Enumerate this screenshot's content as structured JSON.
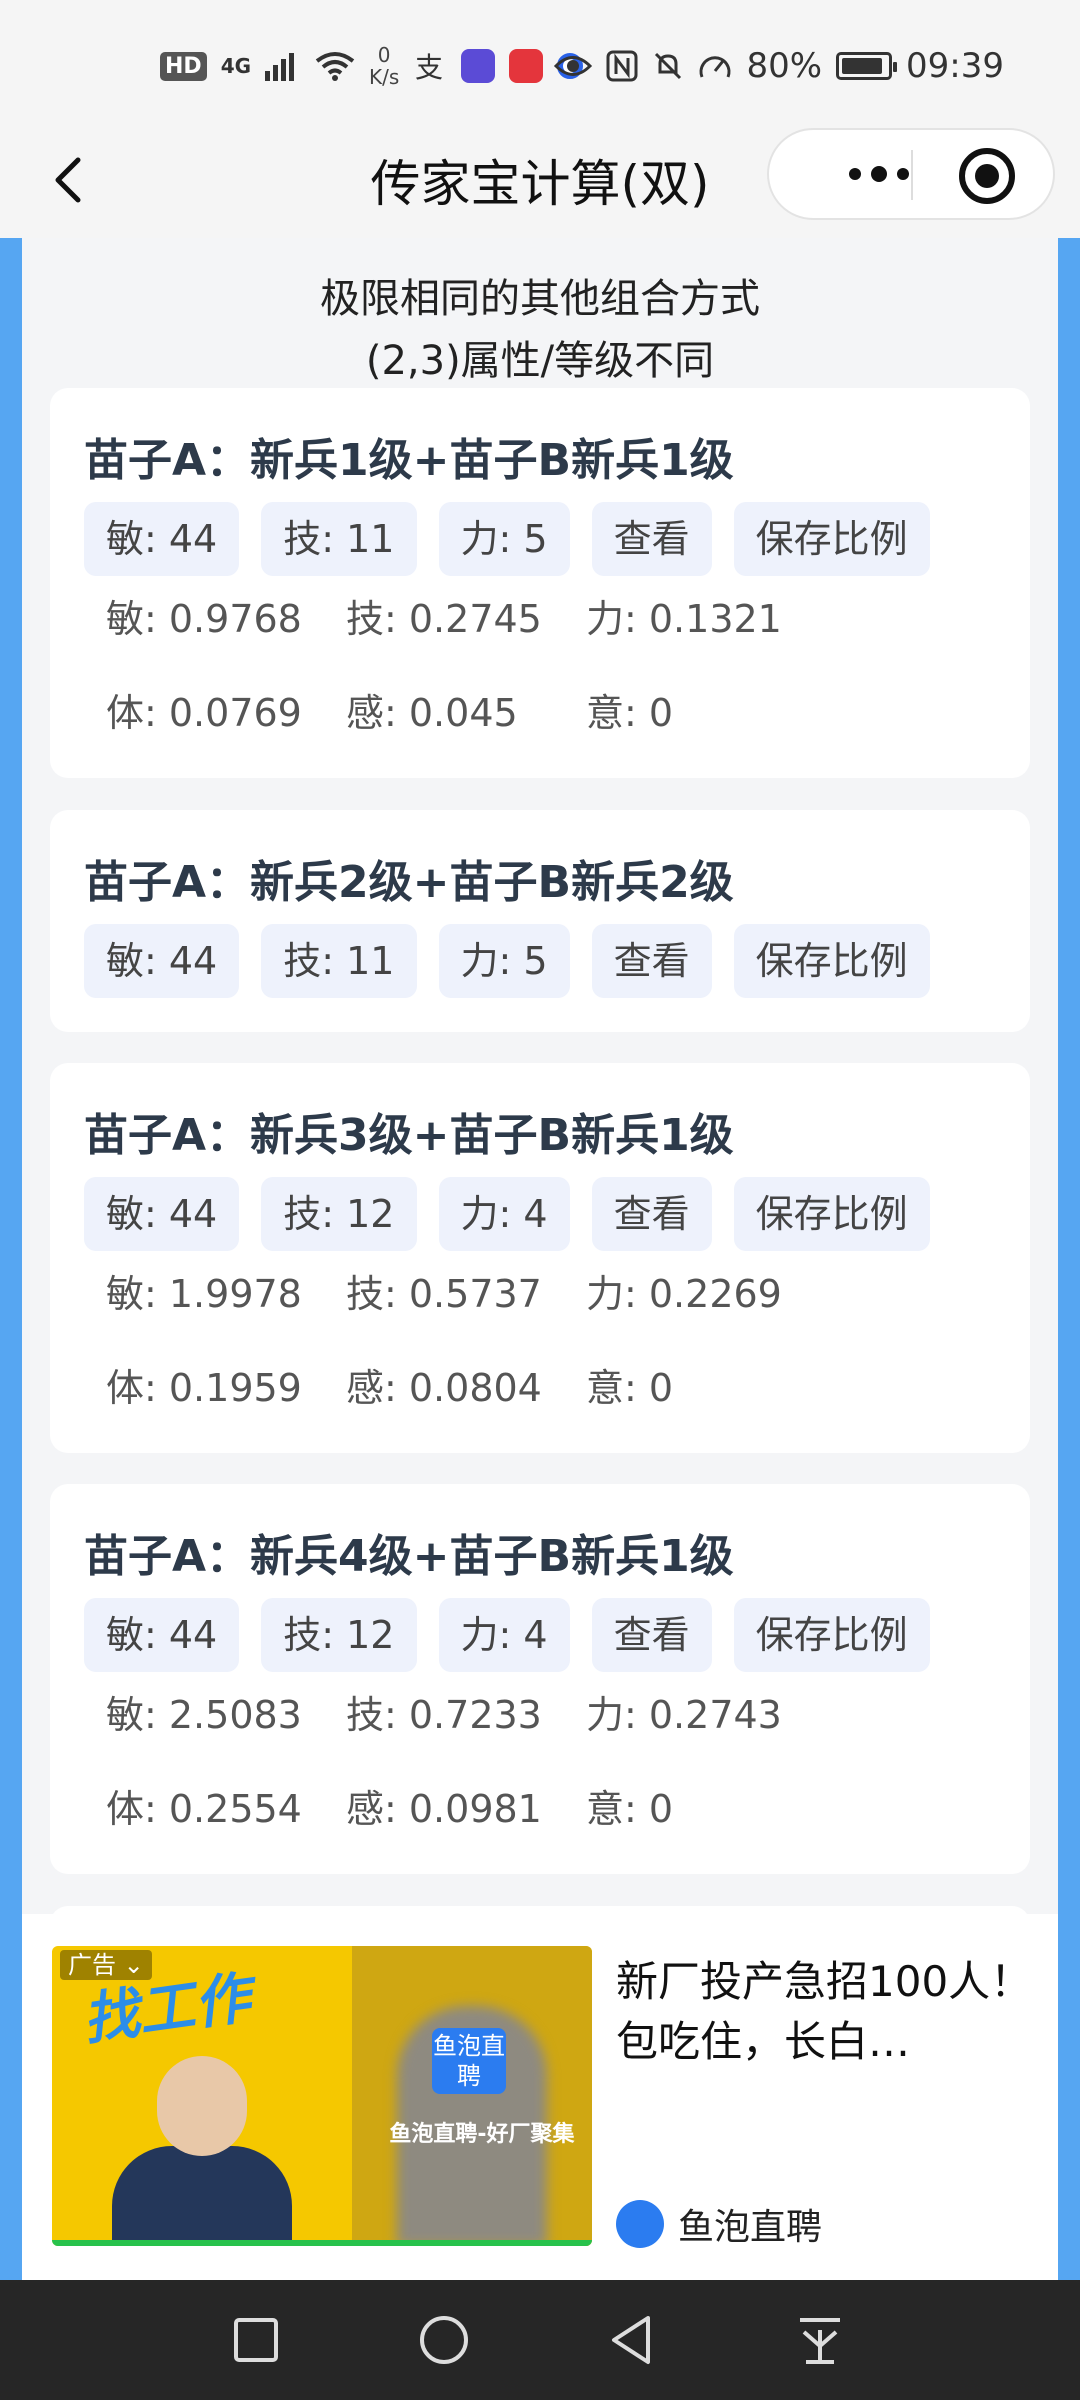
{
  "status_bar": {
    "network_badge": "HD",
    "signal_label": "4G",
    "speed_value": "0",
    "speed_unit": "K/s",
    "battery": "80%",
    "time": "09:39",
    "battery_level": 0.8
  },
  "nav": {
    "title": "传家宝计算(双)"
  },
  "main": {
    "heading_line1": "极限相同的其他组合方式",
    "heading_line2": "(2,3)属性/等级不同",
    "cards": [
      {
        "title": "苗子A：新兵1级+苗子B新兵1级",
        "tags": [
          "敏: 44",
          "技: 11",
          "力: 5",
          "查看",
          "保存比例"
        ],
        "row1": [
          "敏: 0.9768",
          "技: 0.2745",
          "力: 0.1321"
        ],
        "row2": [
          "体: 0.0769",
          "感: 0.045",
          "意: 0"
        ]
      },
      {
        "title": "苗子A：新兵2级+苗子B新兵2级",
        "tags": [
          "敏: 44",
          "技: 11",
          "力: 5",
          "查看",
          "保存比例"
        ]
      },
      {
        "title": "苗子A：新兵3级+苗子B新兵1级",
        "tags": [
          "敏: 44",
          "技: 12",
          "力: 4",
          "查看",
          "保存比例"
        ],
        "row1": [
          "敏: 1.9978",
          "技: 0.5737",
          "力: 0.2269"
        ],
        "row2": [
          "体: 0.1959",
          "感: 0.0804",
          "意: 0"
        ]
      },
      {
        "title": "苗子A：新兵4级+苗子B新兵1级",
        "tags": [
          "敏: 44",
          "技: 12",
          "力: 4",
          "查看",
          "保存比例"
        ],
        "row1": [
          "敏: 2.5083",
          "技: 0.7233",
          "力: 0.2743"
        ],
        "row2": [
          "体: 0.2554",
          "感: 0.0981",
          "意: 0"
        ]
      }
    ]
  },
  "ad": {
    "tag": "广告",
    "image_slogan": "找工作",
    "image_brand": "鱼泡直聘",
    "image_subtitle": "鱼泡直聘-好厂聚集",
    "text": "新厂投产急招100人！包吃住，长白…",
    "brand": "鱼泡直聘"
  },
  "colors": {
    "accent_blue": "#56a6f2",
    "tag_bg": "#eef2fc",
    "title_color": "#2d3a4a"
  }
}
